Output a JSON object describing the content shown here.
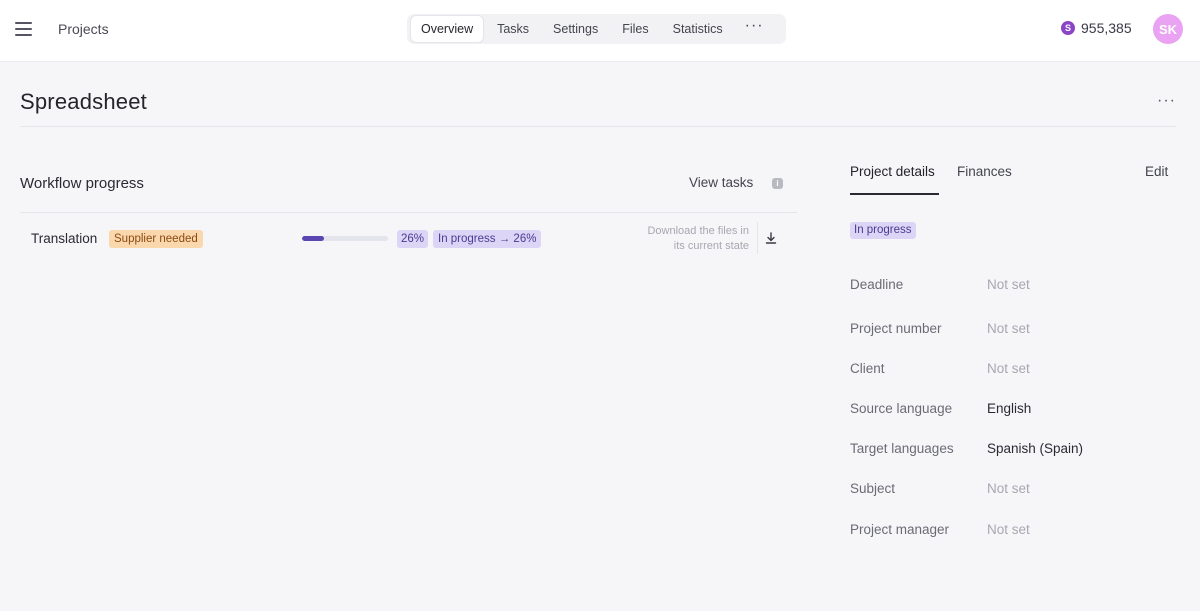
{
  "header": {
    "nav_label": "Projects",
    "tabs": [
      {
        "label": "Overview",
        "active": true
      },
      {
        "label": "Tasks",
        "active": false
      },
      {
        "label": "Settings",
        "active": false
      },
      {
        "label": "Files",
        "active": false
      },
      {
        "label": "Statistics",
        "active": false
      }
    ],
    "more_label": "···",
    "balance_symbol": "S",
    "balance": "955,385",
    "avatar_initials": "SK",
    "avatar_color": "#e9a3f2"
  },
  "page": {
    "title": "Spreadsheet",
    "more_label": "···"
  },
  "workflow": {
    "title": "Workflow progress",
    "view_tasks_label": "View tasks",
    "info_icon": "i",
    "rows": [
      {
        "label": "Translation",
        "supplier_badge": "Supplier needed",
        "progress_percent": 26,
        "percent_label": "26%",
        "status_label": "In progress → 26%",
        "download_text_line1": "Download the files in",
        "download_text_line2": "its current state"
      }
    ]
  },
  "details": {
    "tabs": [
      {
        "label": "Project details",
        "active": true
      },
      {
        "label": "Finances",
        "active": false
      }
    ],
    "edit_label": "Edit",
    "status_badge": "In progress",
    "fields": [
      {
        "label": "Deadline",
        "value": "Not set",
        "is_set": false
      },
      {
        "label": "Project number",
        "value": "Not set",
        "is_set": false
      },
      {
        "label": "Client",
        "value": "Not set",
        "is_set": false
      },
      {
        "label": "Source language",
        "value": "English",
        "is_set": true
      },
      {
        "label": "Target languages",
        "value": "Spanish (Spain)",
        "is_set": true
      },
      {
        "label": "Subject",
        "value": "Not set",
        "is_set": false
      },
      {
        "label": "Project manager",
        "value": "Not set",
        "is_set": false
      }
    ]
  },
  "colors": {
    "accent": "#5a46b0",
    "status_bg": "#ddd5f6",
    "supplier_bg": "#fbd7ae",
    "coin": "#8a45c8"
  }
}
